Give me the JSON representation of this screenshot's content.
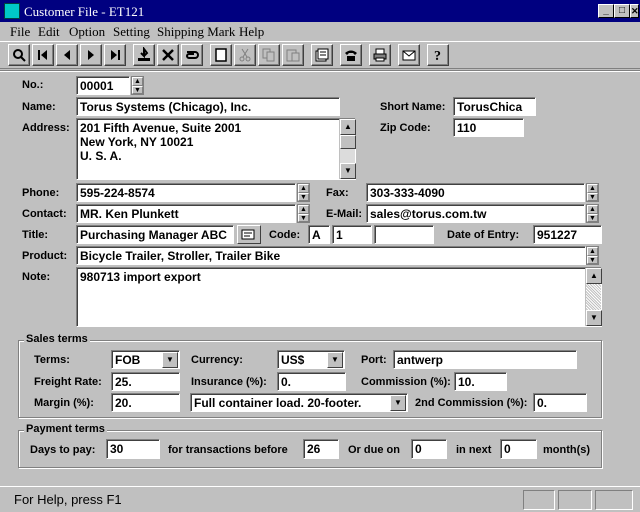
{
  "window": {
    "title": "Customer File - ET121",
    "min": "_",
    "max": "□",
    "close": "✕"
  },
  "menu": [
    "File",
    "Edit",
    "Option",
    "Setting",
    "Shipping Mark",
    "Help"
  ],
  "toolbar_icons": [
    "search-icon",
    "first-record-icon",
    "previous-record-icon",
    "next-record-icon",
    "last-record-icon",
    "save-icon",
    "delete-icon",
    "undo-icon",
    "new-record-icon",
    "cut-icon",
    "copy-icon",
    "paste-icon",
    "report-icon",
    "phone-icon",
    "print-icon",
    "email-icon",
    "help-icon"
  ],
  "labels": {
    "no": "No.:",
    "name": "Name:",
    "address": "Address:",
    "short_name": "Short Name:",
    "zip": "Zip Code:",
    "phone": "Phone:",
    "fax": "Fax:",
    "contact": "Contact:",
    "email": "E-Mail:",
    "title": "Title:",
    "code": "Code:",
    "date_of_entry": "Date of Entry:",
    "product": "Product:",
    "note": "Note:"
  },
  "fields": {
    "no": "00001",
    "name": "Torus Systems (Chicago), Inc.",
    "address": "201 Fifth Avenue, Suite 2001\nNew York, NY 10021\nU. S. A.",
    "short_name": "TorusChica",
    "zip": "110",
    "phone": "595-224-8574",
    "fax": "303-333-4090",
    "contact": "MR. Ken Plunkett",
    "email": "sales@torus.com.tw",
    "title": "Purchasing Manager  ABC",
    "code1": "A",
    "code2": "1",
    "code3": "",
    "date_of_entry": "951227",
    "product": "Bicycle Trailer, Stroller, Trailer Bike",
    "note": "980713 import export"
  },
  "sales_terms": {
    "title": "Sales terms",
    "labels": {
      "terms": "Terms:",
      "currency": "Currency:",
      "port": "Port:",
      "freight": "Freight Rate:",
      "insurance": "Insurance  (%):",
      "commission": "Commission (%):",
      "margin": "Margin (%):",
      "commission2": "2nd Commission (%):"
    },
    "values": {
      "terms": "FOB",
      "currency": "US$",
      "port": "antwerp",
      "freight": "25.",
      "insurance": "0.",
      "commission": "10.",
      "margin": "20.",
      "container": "Full container load. 20-footer.",
      "commission2": "0."
    }
  },
  "payment_terms": {
    "title": "Payment terms",
    "labels": {
      "days": "Days to pay:",
      "before": "for transactions before",
      "due": "Or due on",
      "next": "in next",
      "months": "month(s)"
    },
    "values": {
      "days": "30",
      "before": "26",
      "due": "0",
      "next": "0"
    }
  },
  "status": {
    "text": "For Help, press F1"
  }
}
